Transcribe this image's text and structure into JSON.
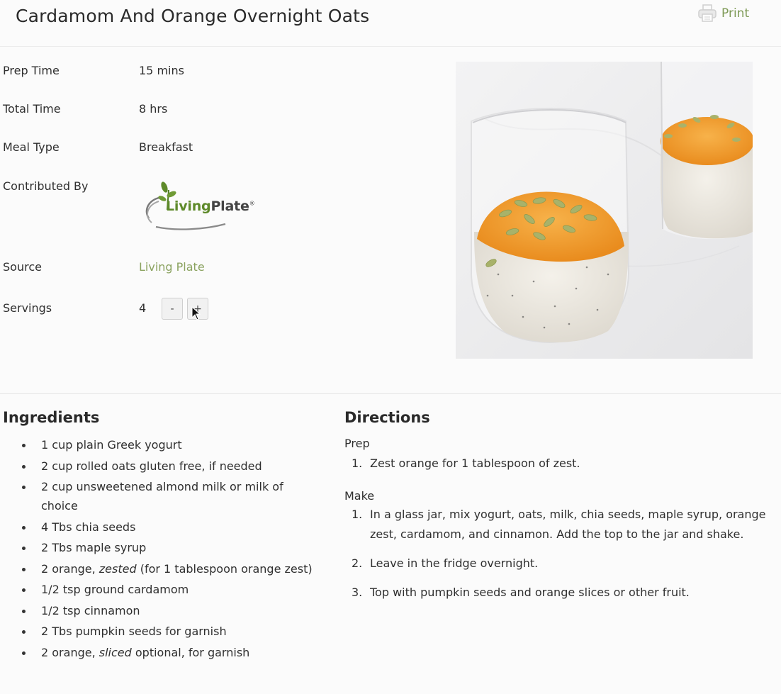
{
  "recipe": {
    "title": "Cardamom And Orange Overnight Oats",
    "print_label": "Print"
  },
  "meta": {
    "prep_time_label": "Prep Time",
    "prep_time_value": "15 mins",
    "total_time_label": "Total Time",
    "total_time_value": "8 hrs",
    "meal_type_label": "Meal Type",
    "meal_type_value": "Breakfast",
    "contributed_by_label": "Contributed By",
    "logo_brand_first": "Living",
    "logo_brand_second": "Plate",
    "source_label": "Source",
    "source_value": "Living Plate",
    "servings_label": "Servings",
    "servings_value": "4",
    "decrease_label": "-",
    "increase_label": "+"
  },
  "ingredients": {
    "heading": "Ingredients",
    "items": [
      {
        "pre": "1 cup plain Greek yogurt",
        "em": "",
        "post": ""
      },
      {
        "pre": "2 cup rolled oats gluten free, if needed",
        "em": "",
        "post": ""
      },
      {
        "pre": "2 cup unsweetened almond milk or milk of choice",
        "em": "",
        "post": ""
      },
      {
        "pre": "4 Tbs chia seeds",
        "em": "",
        "post": ""
      },
      {
        "pre": "2 Tbs maple syrup",
        "em": "",
        "post": ""
      },
      {
        "pre": "2 orange, ",
        "em": "zested",
        "post": " (for 1 tablespoon orange zest)"
      },
      {
        "pre": "1/2 tsp ground cardamom",
        "em": "",
        "post": ""
      },
      {
        "pre": "1/2 tsp cinnamon",
        "em": "",
        "post": ""
      },
      {
        "pre": "2 Tbs pumpkin seeds for garnish",
        "em": "",
        "post": ""
      },
      {
        "pre": "2 orange, ",
        "em": "sliced",
        "post": " optional, for garnish"
      }
    ]
  },
  "directions": {
    "heading": "Directions",
    "prep_heading": "Prep",
    "prep_steps": [
      {
        "num": "1.",
        "text": "Zest orange for 1 tablespoon of zest."
      }
    ],
    "make_heading": "Make",
    "make_steps": [
      {
        "num": "1.",
        "text": "In a glass jar, mix yogurt, oats, milk, chia seeds, maple syrup, orange zest, cardamom, and cinnamon. Add the top to the jar and shake."
      },
      {
        "num": "2.",
        "text": "Leave in the fridge overnight."
      },
      {
        "num": "3.",
        "text": "Top with pumpkin seeds and orange slices or other fruit."
      }
    ]
  },
  "colors": {
    "accent_green": "#8aa25f",
    "logo_green": "#5e8a2a"
  }
}
